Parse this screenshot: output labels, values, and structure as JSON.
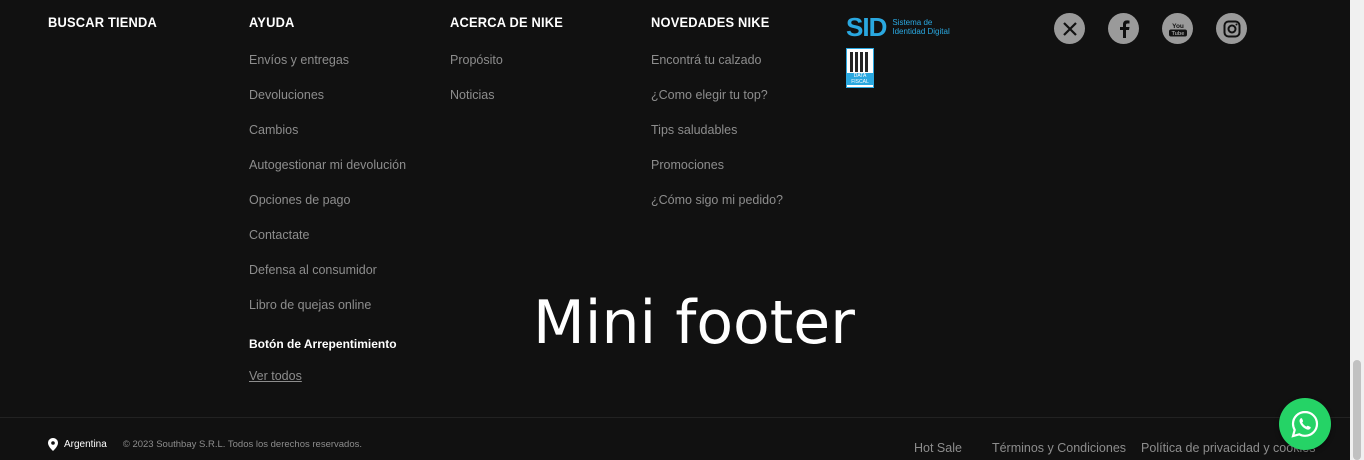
{
  "columns": {
    "buscar": {
      "title": "BUSCAR TIENDA",
      "items": []
    },
    "ayuda": {
      "title": "AYUDA",
      "items": [
        "Envíos y entregas",
        "Devoluciones",
        "Cambios",
        "Autogestionar mi devolución",
        "Opciones de pago",
        "Contactate",
        "Defensa al consumidor",
        "Libro de quejas online"
      ],
      "highlight": "Botón de Arrepentimiento",
      "view_all": "Ver todos"
    },
    "acerca": {
      "title": "ACERCA DE NIKE",
      "items": [
        "Propósito",
        "Noticias"
      ]
    },
    "novedades": {
      "title": "NOVEDADES NIKE",
      "items": [
        "Encontrá tu calzado",
        "¿Como elegir tu top?",
        "Tips saludables",
        "Promociones",
        "¿Cómo sigo mi pedido?"
      ]
    }
  },
  "sid": {
    "mark": "SID",
    "text": "Sistema de Identidad Digital"
  },
  "datafiscal": {
    "label": "DATA FISCAL"
  },
  "social": [
    {
      "icon": "x-icon",
      "glyph": "𝕏"
    },
    {
      "icon": "facebook-icon",
      "glyph": "f"
    },
    {
      "icon": "youtube-icon",
      "glyph": "You Tube"
    },
    {
      "icon": "instagram-icon",
      "glyph": "◎"
    }
  ],
  "overlay": {
    "text": "Mini footer"
  },
  "bottom": {
    "country": "Argentina",
    "copyright": "© 2023 Southbay S.R.L. Todos los derechos reservados."
  },
  "legal": {
    "hot_sale": "Hot Sale",
    "terms": "Términos y Condiciones",
    "privacy": "Política de privacidad y cookies"
  },
  "colors": {
    "background": "#111111",
    "muted": "#8d8d8d",
    "accent_sid": "#2aa8e0",
    "whatsapp": "#25d366"
  }
}
